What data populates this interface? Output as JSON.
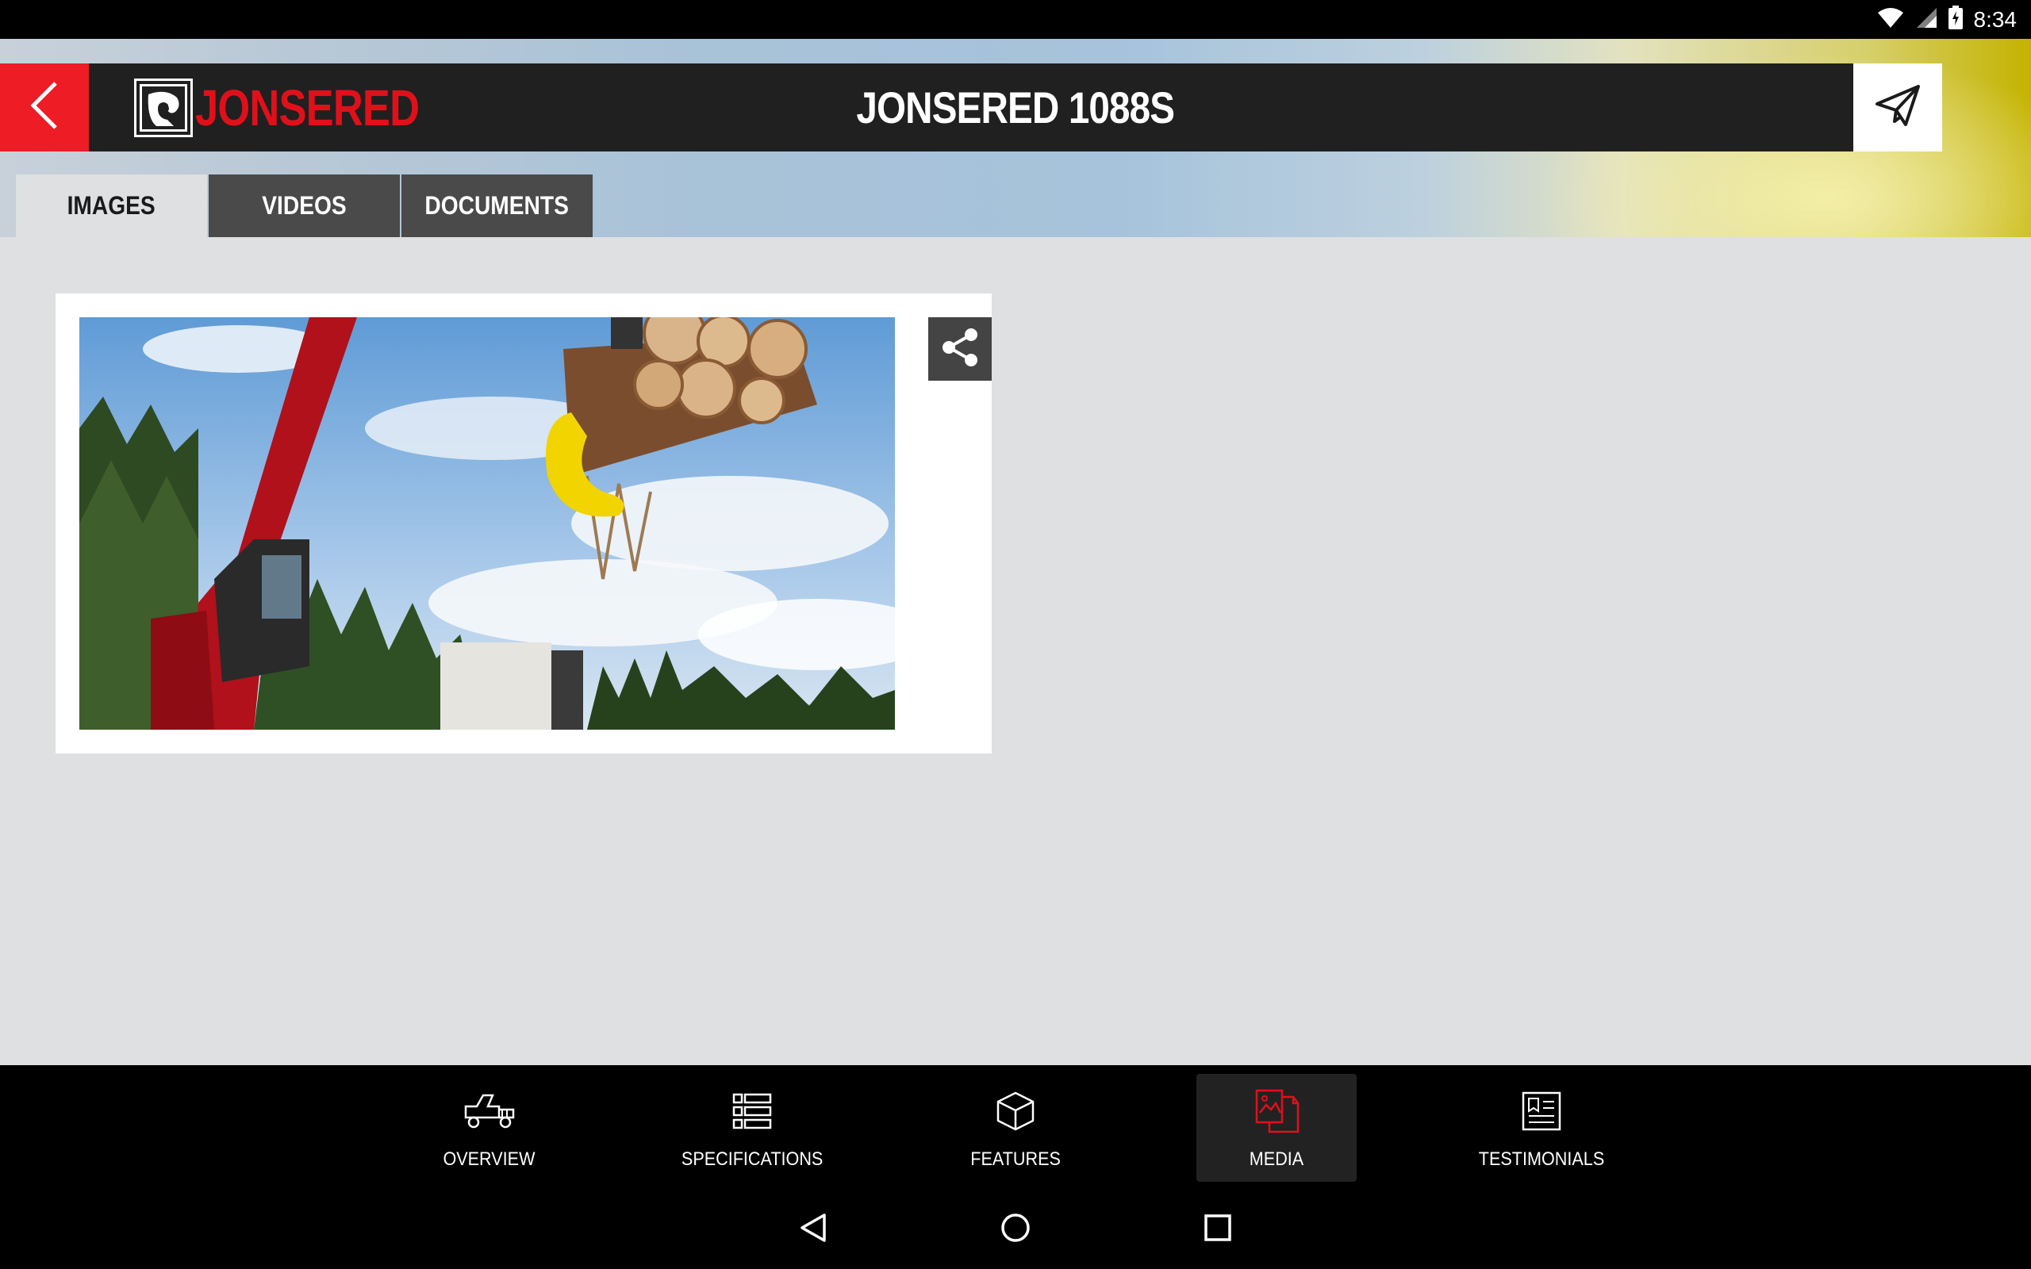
{
  "status_bar": {
    "time": "8:34"
  },
  "header": {
    "brand": "JONSERED",
    "title": "JONSERED 1088S"
  },
  "tabs": [
    {
      "label": "IMAGES",
      "active": true
    },
    {
      "label": "VIDEOS",
      "active": false
    },
    {
      "label": "DOCUMENTS",
      "active": false
    }
  ],
  "bottom_nav": [
    {
      "label": "OVERVIEW",
      "icon": "truck-icon",
      "active": false
    },
    {
      "label": "SPECIFICATIONS",
      "icon": "list-icon",
      "active": false
    },
    {
      "label": "FEATURES",
      "icon": "cube-icon",
      "active": false
    },
    {
      "label": "MEDIA",
      "icon": "media-icon",
      "active": true
    },
    {
      "label": "TESTIMONIALS",
      "icon": "document-icon",
      "active": false
    }
  ],
  "colors": {
    "brand_red": "#ee1c24",
    "header_dark": "#202020",
    "tab_dark": "#4a4a4a",
    "page_bg": "#dfe0e2",
    "active_icon": "#e0101b"
  }
}
